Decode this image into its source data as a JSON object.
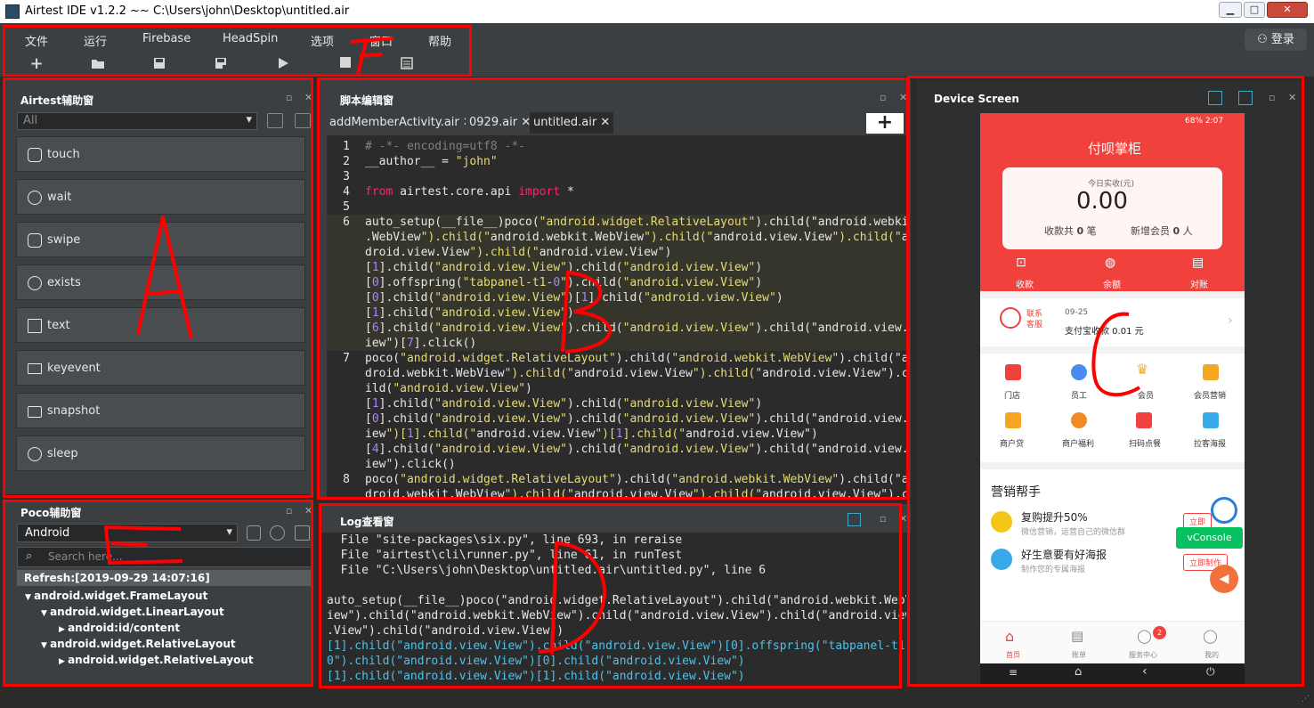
{
  "window": {
    "title": "Airtest IDE v1.2.2 ~~ C:\\Users\\john\\Desktop\\untitled.air",
    "min": "▁",
    "max": "□",
    "close": "✕"
  },
  "menu": {
    "items": [
      "文件",
      "运行",
      "Firebase",
      "HeadSpin",
      "选项",
      "窗口",
      "帮助"
    ],
    "login": "登录",
    "toolbar_icons": [
      "new-icon",
      "open-icon",
      "save-icon",
      "save-as-icon",
      "play-icon",
      "stop-icon",
      "log-icon"
    ]
  },
  "airtest_panel": {
    "title": "Airtest辅助窗",
    "filter": "All",
    "buttons": [
      {
        "label": "touch",
        "icon": "touch-icon"
      },
      {
        "label": "wait",
        "icon": "clock-icon"
      },
      {
        "label": "swipe",
        "icon": "swipe-icon"
      },
      {
        "label": "exists",
        "icon": "check-icon"
      },
      {
        "label": "text",
        "icon": "text-icon"
      },
      {
        "label": "keyevent",
        "icon": "keyboard-icon"
      },
      {
        "label": "snapshot",
        "icon": "camera-icon"
      },
      {
        "label": "sleep",
        "icon": "moon-icon"
      }
    ]
  },
  "poco_panel": {
    "title": "Poco辅助窗",
    "mode": "Android",
    "search_placeholder": "Search here...",
    "refresh": "Refresh:[2019-09-29 14:07:16]",
    "tree": [
      {
        "label": "android.widget.FrameLayout",
        "expanded": true
      },
      {
        "label": "android.widget.LinearLayout",
        "expanded": true
      },
      {
        "label": "android:id/content",
        "expanded": false
      },
      {
        "label": "android.widget.RelativeLayout",
        "expanded": true
      },
      {
        "label": "android.widget.RelativeLayout",
        "expanded": false
      }
    ]
  },
  "editor": {
    "title": "脚本编辑窗",
    "tabs": [
      "addMemberActivity.air",
      "0929.air",
      "untitled.air"
    ],
    "tab_close": "✕",
    "add_tab": "+",
    "lines": [
      {
        "n": "1",
        "t": "# -*- encoding=utf8 -*-"
      },
      {
        "n": "2",
        "t": "__author__ = \"john\""
      },
      {
        "n": "3",
        "t": ""
      },
      {
        "n": "4",
        "t": "from airtest.core.api import *"
      },
      {
        "n": "5",
        "t": ""
      },
      {
        "n": "6",
        "t": "auto_setup(__file__)poco(\"android.widget.RelativeLayout\").child(\"android.webkit"
      },
      {
        "n": "",
        "t": ".WebView\").child(\"android.webkit.WebView\").child(\"android.view.View\").child(\"an"
      },
      {
        "n": "",
        "t": "droid.view.View\").child(\"android.view.View\")"
      },
      {
        "n": "",
        "t": "[1].child(\"android.view.View\").child(\"android.view.View\")"
      },
      {
        "n": "",
        "t": "[0].offspring(\"tabpanel-t1-0\").child(\"android.view.View\")"
      },
      {
        "n": "",
        "t": "[0].child(\"android.view.View\")[1].child(\"android.view.View\")"
      },
      {
        "n": "",
        "t": "[1].child(\"android.view.View\")"
      },
      {
        "n": "",
        "t": "[6].child(\"android.view.View\").child(\"android.view.View\").child(\"android.view.V"
      },
      {
        "n": "",
        "t": "iew\")[7].click()"
      },
      {
        "n": "7",
        "t": "poco(\"android.widget.RelativeLayout\").child(\"android.webkit.WebView\").child(\"an"
      },
      {
        "n": "",
        "t": "droid.webkit.WebView\").child(\"android.view.View\").child(\"android.view.View\").ch"
      },
      {
        "n": "",
        "t": "ild(\"android.view.View\")"
      },
      {
        "n": "",
        "t": "[1].child(\"android.view.View\").child(\"android.view.View\")"
      },
      {
        "n": "",
        "t": "[0].child(\"android.view.View\").child(\"android.view.View\").child(\"android.view.V"
      },
      {
        "n": "",
        "t": "iew\")[1].child(\"android.view.View\")[1].child(\"android.view.View\")"
      },
      {
        "n": "",
        "t": "[4].child(\"android.view.View\").child(\"android.view.View\").child(\"android.view.V"
      },
      {
        "n": "",
        "t": "iew\").click()"
      },
      {
        "n": "8",
        "t": "poco(\"android.widget.RelativeLayout\").child(\"android.webkit.WebView\").child(\"an"
      },
      {
        "n": "",
        "t": "droid.webkit.WebView\").child(\"android.view.View\").child(\"android.view.View\").ch"
      }
    ]
  },
  "log": {
    "title": "Log查看窗",
    "lines": [
      "  File \"site-packages\\six.py\", line 693, in reraise",
      "  File \"airtest\\cli\\runner.py\", line 61, in runTest",
      "  File \"C:\\Users\\john\\Desktop\\untitled.air\\untitled.py\", line 6",
      "",
      "auto_setup(__file__)poco(\"android.widget.RelativeLayout\").child(\"android.webkit.WebV",
      "iew\").child(\"android.webkit.WebView\").child(\"android.view.View\").child(\"android.view",
      ".View\").child(\"android.view.View\")",
      "[1].child(\"android.view.View\").child(\"android.view.View\")[0].offspring(\"tabpanel-t1-",
      "0\").child(\"android.view.View\")[0].child(\"android.view.View\")",
      "[1].child(\"android.view.View\")[1].child(\"android.view.View\")"
    ]
  },
  "device": {
    "title": "Device Screen",
    "status_right": "68% 2:07",
    "app_title": "付呗掌柜",
    "income_label": "今日实收(元)",
    "income_value": "0.00",
    "collect_count_prefix": "收款共",
    "collect_count": "0",
    "collect_count_unit": "笔",
    "new_member_prefix": "新增会员",
    "new_member": "0",
    "new_member_unit": "人",
    "actions": [
      "收款",
      "余额",
      "对账"
    ],
    "notice_icon_label": "联系客服",
    "notice_date": "09-25",
    "notice_text": "支付宝收款 0.01 元",
    "grid": [
      "门店",
      "员工",
      "会员",
      "会员营销",
      "商户贷",
      "商户福利",
      "扫码点餐",
      "拉客海报"
    ],
    "marketing_title": "营销帮手",
    "promo1_title": "复购提升50%",
    "promo1_sub": "微信营销，运营自己的微信群",
    "promo1_btn": "立即",
    "promo2_title": "好生意要有好海报",
    "promo2_sub": "制作您的专属海报",
    "promo2_btn": "立即制作",
    "vconsole": "vConsole",
    "nav": [
      "首页",
      "账单",
      "服务中心",
      "我的"
    ],
    "nav_badge": "2",
    "accent": "#f0413c"
  },
  "annotations": [
    "F",
    "A",
    "B",
    "C",
    "D",
    "E"
  ]
}
